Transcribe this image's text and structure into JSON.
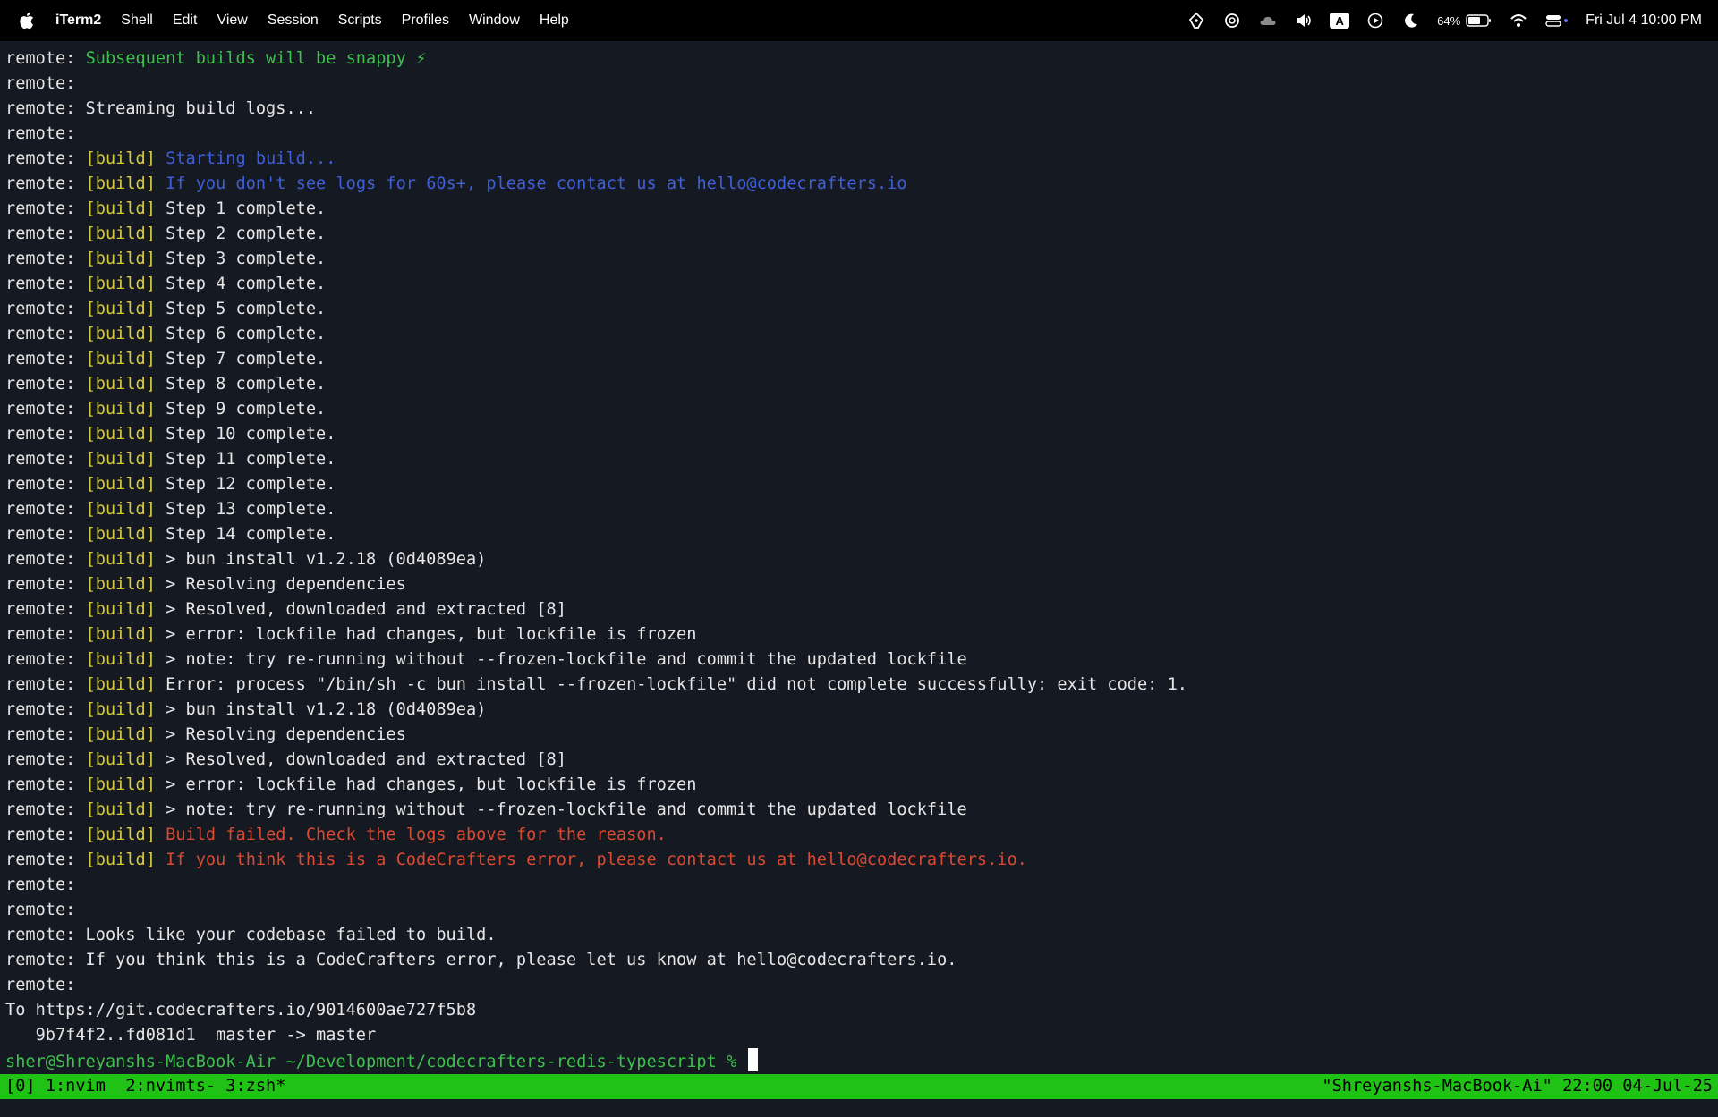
{
  "menubar": {
    "app_name": "iTerm2",
    "menus": [
      "Shell",
      "Edit",
      "View",
      "Session",
      "Scripts",
      "Profiles",
      "Window",
      "Help"
    ],
    "input_source": "A",
    "battery_percent": "64%",
    "clock": "Fri Jul 4  10:00 PM",
    "status_icons": [
      "pen-tool-icon",
      "openai-icon",
      "cloud-icon",
      "volume-icon",
      "input-source-icon",
      "play-icon",
      "moon-icon",
      "battery-icon",
      "wifi-icon",
      "control-center-icon"
    ]
  },
  "colors": {
    "background": "#151a22",
    "build_tag": "#d7c93c",
    "success": "#3ec04e",
    "info": "#3f5fd9",
    "error": "#d94a31",
    "tmux_bar": "#1fc215"
  },
  "terminal": {
    "lines": [
      [
        {
          "t": "remote: "
        },
        {
          "t": "Subsequent builds will be snappy ⚡",
          "c": "green"
        }
      ],
      [
        {
          "t": "remote:"
        }
      ],
      [
        {
          "t": "remote: Streaming build logs..."
        }
      ],
      [
        {
          "t": "remote:"
        }
      ],
      [
        {
          "t": "remote: "
        },
        {
          "t": "[build]",
          "c": "build"
        },
        {
          "t": " "
        },
        {
          "t": "Starting build...",
          "c": "blue"
        }
      ],
      [
        {
          "t": "remote: "
        },
        {
          "t": "[build]",
          "c": "build"
        },
        {
          "t": " "
        },
        {
          "t": "If you don't see logs for 60s+, please contact us at hello@codecrafters.io",
          "c": "blue"
        }
      ],
      [
        {
          "t": "remote: "
        },
        {
          "t": "[build]",
          "c": "build"
        },
        {
          "t": " Step 1 complete."
        }
      ],
      [
        {
          "t": "remote: "
        },
        {
          "t": "[build]",
          "c": "build"
        },
        {
          "t": " Step 2 complete."
        }
      ],
      [
        {
          "t": "remote: "
        },
        {
          "t": "[build]",
          "c": "build"
        },
        {
          "t": " Step 3 complete."
        }
      ],
      [
        {
          "t": "remote: "
        },
        {
          "t": "[build]",
          "c": "build"
        },
        {
          "t": " Step 4 complete."
        }
      ],
      [
        {
          "t": "remote: "
        },
        {
          "t": "[build]",
          "c": "build"
        },
        {
          "t": " Step 5 complete."
        }
      ],
      [
        {
          "t": "remote: "
        },
        {
          "t": "[build]",
          "c": "build"
        },
        {
          "t": " Step 6 complete."
        }
      ],
      [
        {
          "t": "remote: "
        },
        {
          "t": "[build]",
          "c": "build"
        },
        {
          "t": " Step 7 complete."
        }
      ],
      [
        {
          "t": "remote: "
        },
        {
          "t": "[build]",
          "c": "build"
        },
        {
          "t": " Step 8 complete."
        }
      ],
      [
        {
          "t": "remote: "
        },
        {
          "t": "[build]",
          "c": "build"
        },
        {
          "t": " Step 9 complete."
        }
      ],
      [
        {
          "t": "remote: "
        },
        {
          "t": "[build]",
          "c": "build"
        },
        {
          "t": " Step 10 complete."
        }
      ],
      [
        {
          "t": "remote: "
        },
        {
          "t": "[build]",
          "c": "build"
        },
        {
          "t": " Step 11 complete."
        }
      ],
      [
        {
          "t": "remote: "
        },
        {
          "t": "[build]",
          "c": "build"
        },
        {
          "t": " Step 12 complete."
        }
      ],
      [
        {
          "t": "remote: "
        },
        {
          "t": "[build]",
          "c": "build"
        },
        {
          "t": " Step 13 complete."
        }
      ],
      [
        {
          "t": "remote: "
        },
        {
          "t": "[build]",
          "c": "build"
        },
        {
          "t": " Step 14 complete."
        }
      ],
      [
        {
          "t": "remote: "
        },
        {
          "t": "[build]",
          "c": "build"
        },
        {
          "t": " > bun install v1.2.18 (0d4089ea)"
        }
      ],
      [
        {
          "t": "remote: "
        },
        {
          "t": "[build]",
          "c": "build"
        },
        {
          "t": " > Resolving dependencies"
        }
      ],
      [
        {
          "t": "remote: "
        },
        {
          "t": "[build]",
          "c": "build"
        },
        {
          "t": " > Resolved, downloaded and extracted [8]"
        }
      ],
      [
        {
          "t": "remote: "
        },
        {
          "t": "[build]",
          "c": "build"
        },
        {
          "t": " > error: lockfile had changes, but lockfile is frozen"
        }
      ],
      [
        {
          "t": "remote: "
        },
        {
          "t": "[build]",
          "c": "build"
        },
        {
          "t": " > note: try re-running without --frozen-lockfile and commit the updated lockfile"
        }
      ],
      [
        {
          "t": "remote: "
        },
        {
          "t": "[build]",
          "c": "build"
        },
        {
          "t": " Error: process \"/bin/sh -c bun install --frozen-lockfile\" did not complete successfully: exit code: 1."
        }
      ],
      [
        {
          "t": "remote: "
        },
        {
          "t": "[build]",
          "c": "build"
        },
        {
          "t": " > bun install v1.2.18 (0d4089ea)"
        }
      ],
      [
        {
          "t": "remote: "
        },
        {
          "t": "[build]",
          "c": "build"
        },
        {
          "t": " > Resolving dependencies"
        }
      ],
      [
        {
          "t": "remote: "
        },
        {
          "t": "[build]",
          "c": "build"
        },
        {
          "t": " > Resolved, downloaded and extracted [8]"
        }
      ],
      [
        {
          "t": "remote: "
        },
        {
          "t": "[build]",
          "c": "build"
        },
        {
          "t": " > error: lockfile had changes, but lockfile is frozen"
        }
      ],
      [
        {
          "t": "remote: "
        },
        {
          "t": "[build]",
          "c": "build"
        },
        {
          "t": " > note: try re-running without --frozen-lockfile and commit the updated lockfile"
        }
      ],
      [
        {
          "t": "remote: "
        },
        {
          "t": "[build]",
          "c": "build"
        },
        {
          "t": " "
        },
        {
          "t": "Build failed. Check the logs above for the reason.",
          "c": "red"
        }
      ],
      [
        {
          "t": "remote: "
        },
        {
          "t": "[build]",
          "c": "build"
        },
        {
          "t": " "
        },
        {
          "t": "If you think this is a CodeCrafters error, please contact us at hello@codecrafters.io.",
          "c": "red"
        }
      ],
      [
        {
          "t": "remote:"
        }
      ],
      [
        {
          "t": "remote:"
        }
      ],
      [
        {
          "t": "remote: Looks like your codebase failed to build."
        }
      ],
      [
        {
          "t": "remote: If you think this is a CodeCrafters error, please let us know at hello@codecrafters.io."
        }
      ],
      [
        {
          "t": "remote:"
        }
      ],
      [
        {
          "t": "To https://git.codecrafters.io/9014600ae727f5b8"
        }
      ],
      [
        {
          "t": "   9b7f4f2..fd081d1  master -> master"
        }
      ]
    ],
    "prompt": "sher@Shreyanshs-MacBook-Air ~/Development/codecrafters-redis-typescript % "
  },
  "tmux": {
    "left": "[0] 1:nvim  2:nvimts- 3:zsh*",
    "right": "\"Shreyanshs-MacBook-Ai\" 22:00 04-Jul-25"
  }
}
